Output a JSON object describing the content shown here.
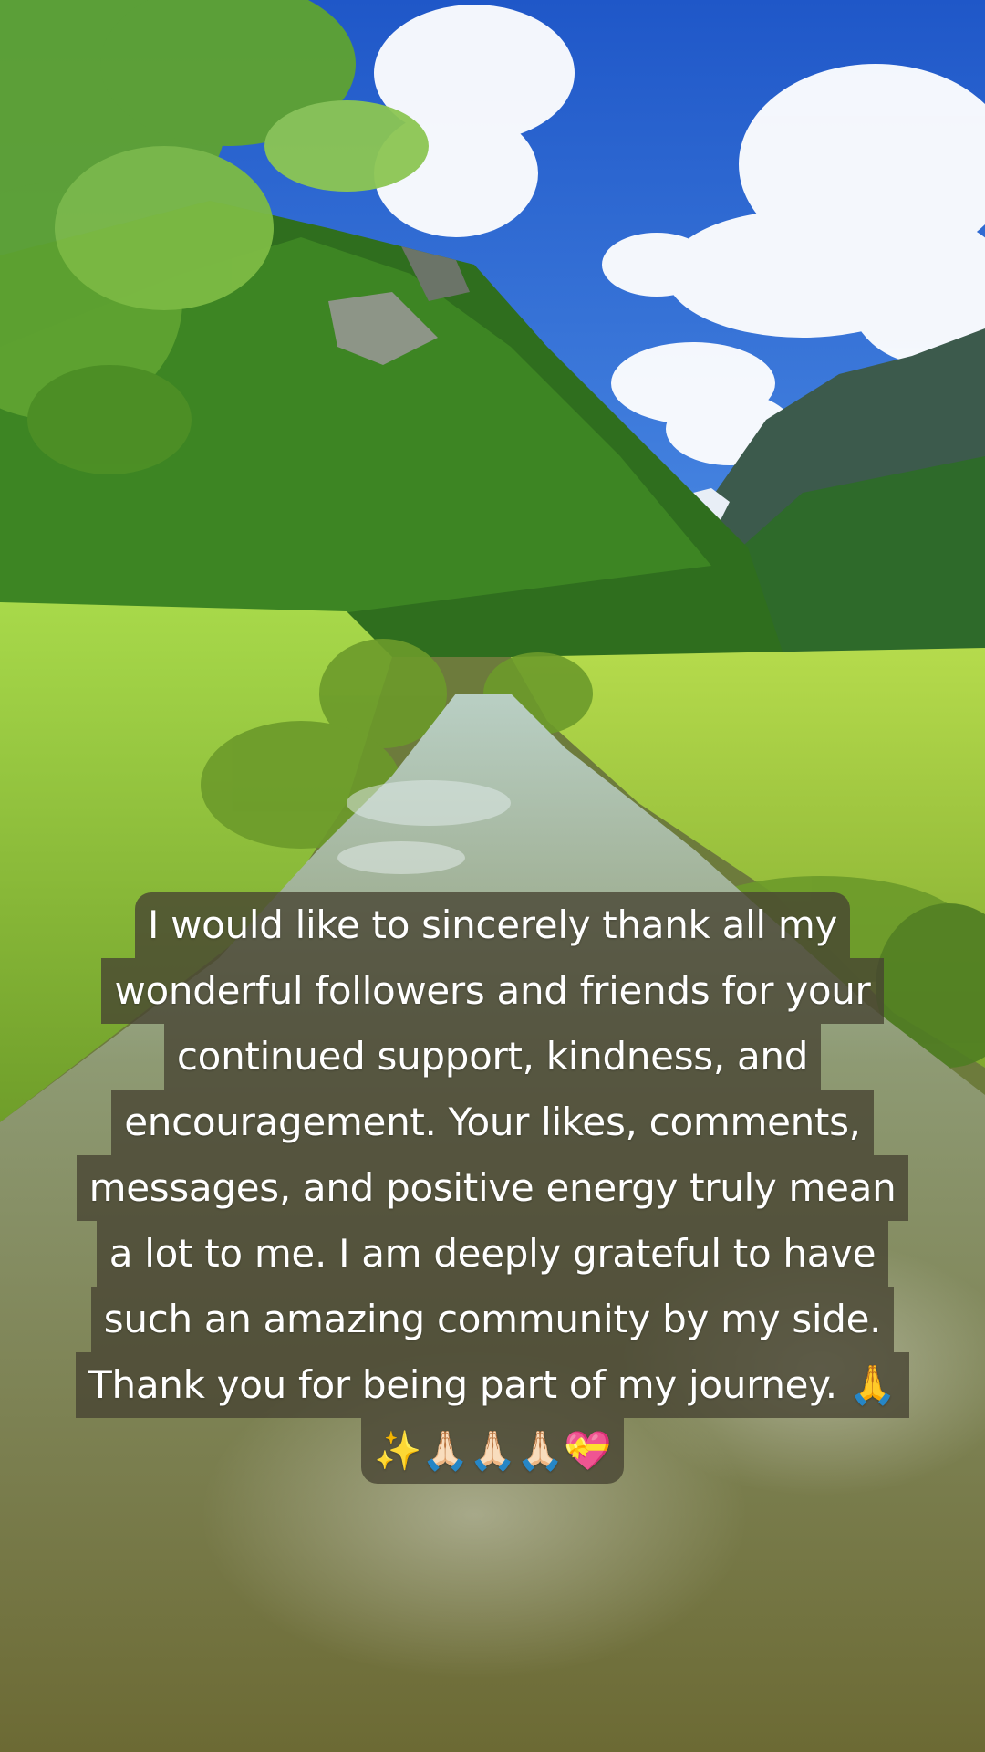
{
  "post": {
    "caption_lines": [
      "I would like to sincerely thank all my",
      "wonderful followers and friends for your",
      "continued support, kindness, and",
      "encouragement. Your likes, comments,",
      "messages, and positive energy truly mean",
      "a lot to me. I am deeply grateful to have",
      "such an amazing community by my side.",
      "Thank you for being part of my journey. 🙏",
      "✨🙏🏻🙏🏻🙏🏻💝"
    ]
  },
  "colors": {
    "sky": "#2f6fd6",
    "grass": "#9fd23c",
    "forest": "#2f6b1c",
    "water": "#8f8a4e",
    "caption_bg": "#464232"
  }
}
